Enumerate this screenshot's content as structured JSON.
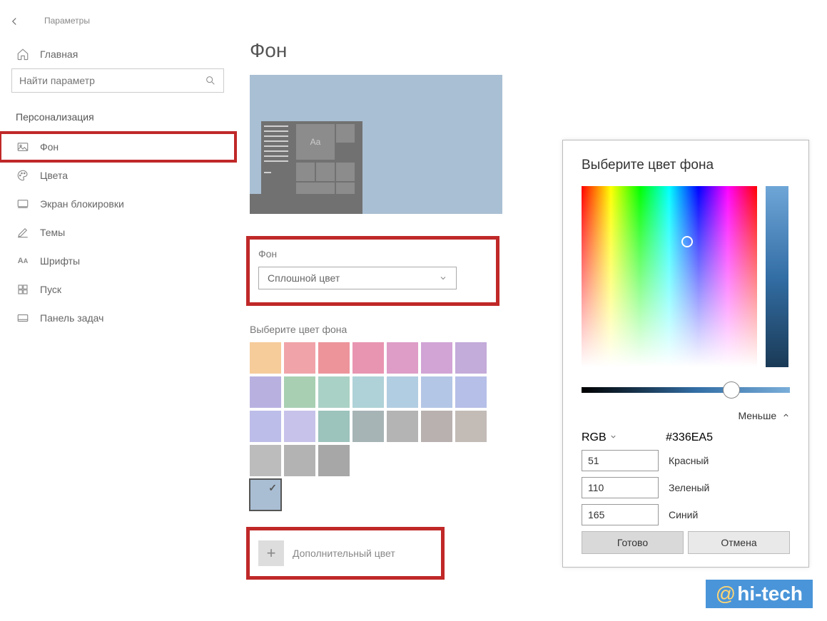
{
  "app_title": "Параметры",
  "search_placeholder": "Найти параметр",
  "section": "Персонализация",
  "nav": {
    "home": "Главная",
    "background": "Фон",
    "colors": "Цвета",
    "lockscreen": "Экран блокировки",
    "themes": "Темы",
    "fonts": "Шрифты",
    "start": "Пуск",
    "taskbar": "Панель задач"
  },
  "page": {
    "title": "Фон",
    "preview_sample": "Aa",
    "dropdown_label": "Фон",
    "dropdown_value": "Сплошной цвет",
    "swatch_label": "Выберите цвет фона",
    "custom_color_label": "Дополнительный цвет",
    "swatch_colors": [
      "#f6cc9b",
      "#f0a4a9",
      "#ed949b",
      "#e895b1",
      "#de9dc7",
      "#d1a4d5",
      "#c3abda",
      "#b8b1e0",
      "#a8cfb2",
      "#aad1c5",
      "#aed2d7",
      "#b1cde1",
      "#b3c6e5",
      "#b6bfe7",
      "#bdbde9",
      "#c7c2ea",
      "#9cc3bc",
      "#a7b4b6",
      "#b4b4b4",
      "#b8b1af",
      "#c2bbb6",
      "#bcbcbc",
      "#b3b3b3",
      "#a7a7a7"
    ],
    "selected_swatch": "#a9bed3"
  },
  "picker": {
    "title": "Выберите цвет фона",
    "less": "Меньше",
    "model": "RGB",
    "hex": "#336EA5",
    "r": "51",
    "r_label": "Красный",
    "g": "110",
    "g_label": "Зеленый",
    "b": "165",
    "b_label": "Синий",
    "ok": "Готово",
    "cancel": "Отмена"
  },
  "watermark": "hi-tech"
}
